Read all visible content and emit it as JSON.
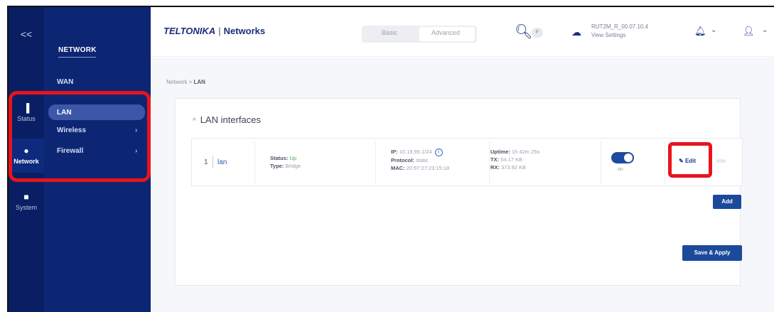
{
  "rail": {
    "collapse_icon": "double-chevron-left-icon",
    "items": [
      {
        "label": "Status",
        "icon": "bars-icon"
      },
      {
        "label": "Network",
        "icon": "globe-icon"
      },
      {
        "label": "System",
        "icon": "document-icon"
      }
    ]
  },
  "subnav": {
    "title": "NETWORK",
    "items": [
      {
        "label": "WAN"
      },
      {
        "label": "LAN"
      },
      {
        "label": "Wireless"
      },
      {
        "label": "Firewall"
      }
    ]
  },
  "header": {
    "logo_brand": "TELTONIKA",
    "logo_sep": "|",
    "logo_net": "Networks",
    "mode_basic": "Basic",
    "mode_advanced": "Advanced",
    "search_badge": "F",
    "fw_version": "RUT2M_R_00.07.10.4",
    "view_settings": "View Settings"
  },
  "breadcrumb": {
    "parent": "Network",
    "separator": ">",
    "current": "LAN"
  },
  "section": {
    "title": "LAN interfaces",
    "collapse_glyph": "^"
  },
  "interfaces": [
    {
      "index": "1",
      "name": "lan",
      "status_label": "Status:",
      "status_value": "Up",
      "type_label": "Type:",
      "type_value": "Bridge",
      "ip_label": "IP:",
      "ip_value": "10.19.95.1/24",
      "protocol_label": "Protocol:",
      "protocol_value": "static",
      "mac_label": "MAC:",
      "mac_value": "20:97:27:23:15:18",
      "uptime_label": "Uptime:",
      "uptime_value": "1h 42m 25s",
      "tx_label": "TX:",
      "tx_value": "54.17 KB",
      "rx_label": "RX:",
      "rx_value": "373.92 KB",
      "toggle_label": "on",
      "edit_label": "Edit",
      "delete_label": "lete"
    }
  ],
  "buttons": {
    "add": "Add",
    "save_apply": "Save & Apply"
  },
  "colors": {
    "rail": "#0a1f63",
    "subnav": "#0d2673",
    "highlight": "#e8141b",
    "primary": "#1b4a9a"
  }
}
